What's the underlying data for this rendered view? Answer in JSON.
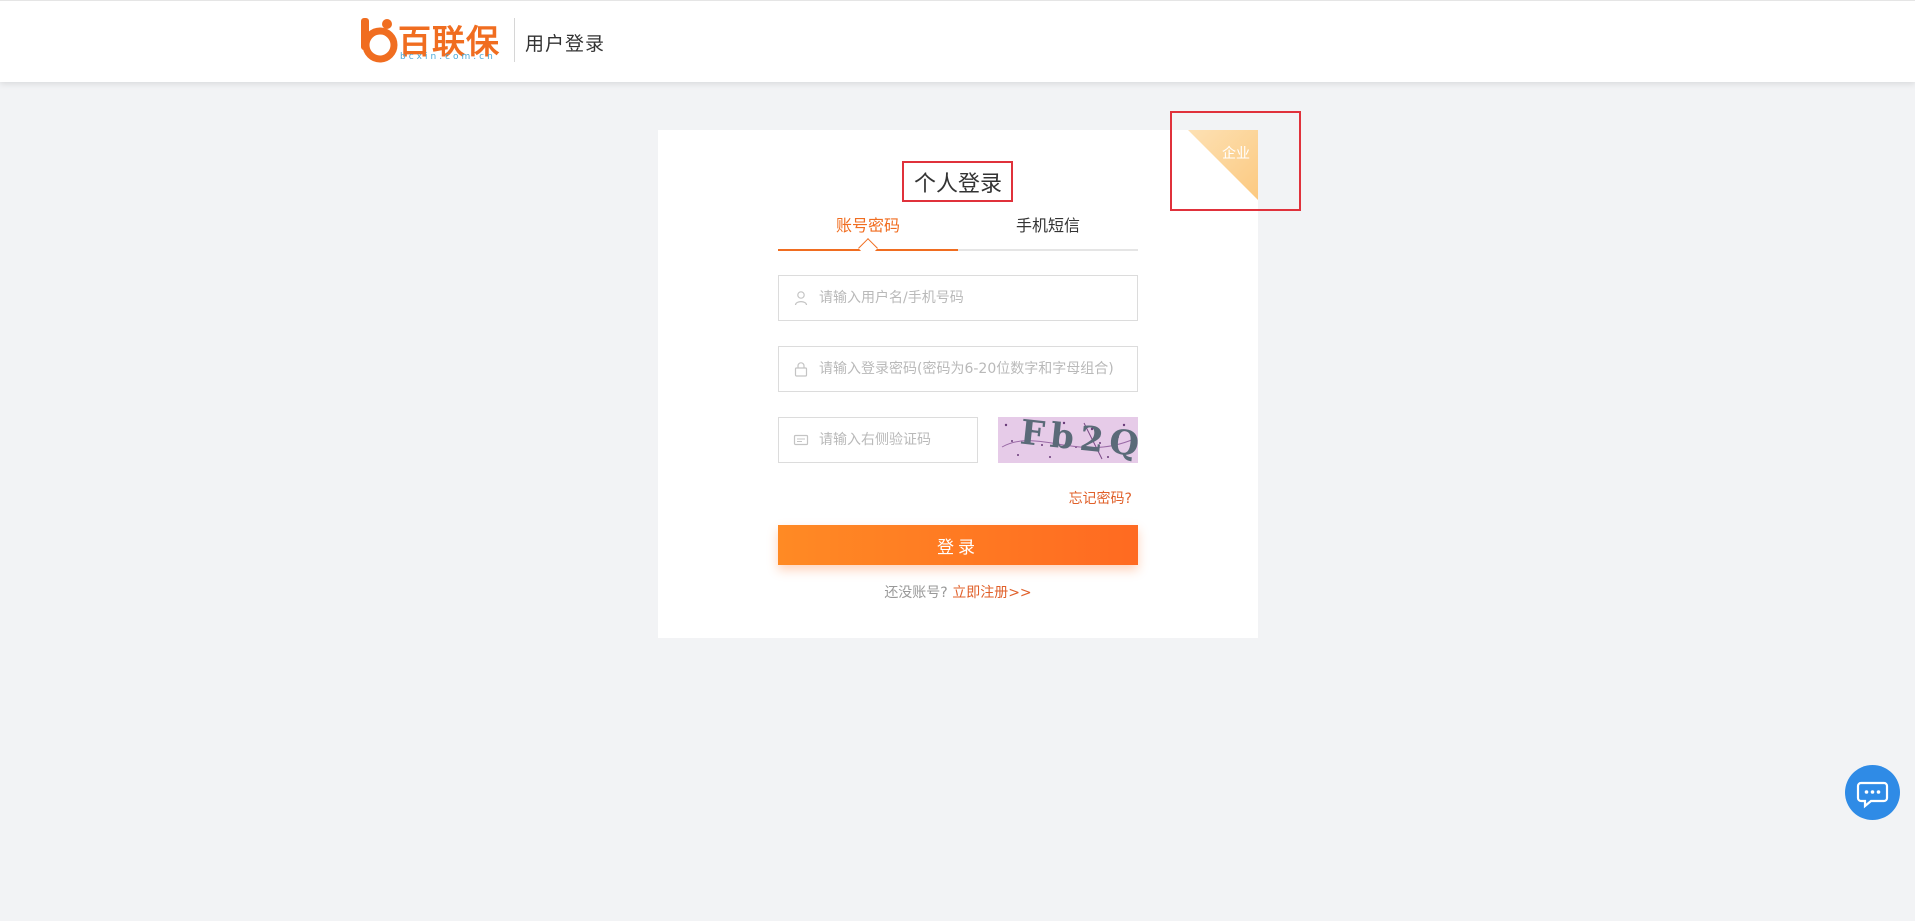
{
  "header": {
    "logo_text": "百联保",
    "logo_url": "bcxin.com.cn",
    "title": "用户登录"
  },
  "login": {
    "corner_label": "企业",
    "title": "个人登录",
    "tabs": [
      {
        "label": "账号密码",
        "active": true
      },
      {
        "label": "手机短信",
        "active": false
      }
    ],
    "username_placeholder": "请输入用户名/手机号码",
    "password_placeholder": "请输入登录密码(密码为6-20位数字和字母组合)",
    "captcha_placeholder": "请输入右侧验证码",
    "captcha_text": "Fb2Q",
    "forgot_label": "忘记密码?",
    "submit_label": "登录",
    "register_prompt": "还没账号?",
    "register_link": "立即注册>>"
  },
  "colors": {
    "accent": "#f06d20",
    "highlight": "#e0313b",
    "chat": "#2f8be6"
  },
  "icons": [
    "user-icon",
    "lock-icon",
    "captcha-card-icon",
    "chat-icon"
  ]
}
